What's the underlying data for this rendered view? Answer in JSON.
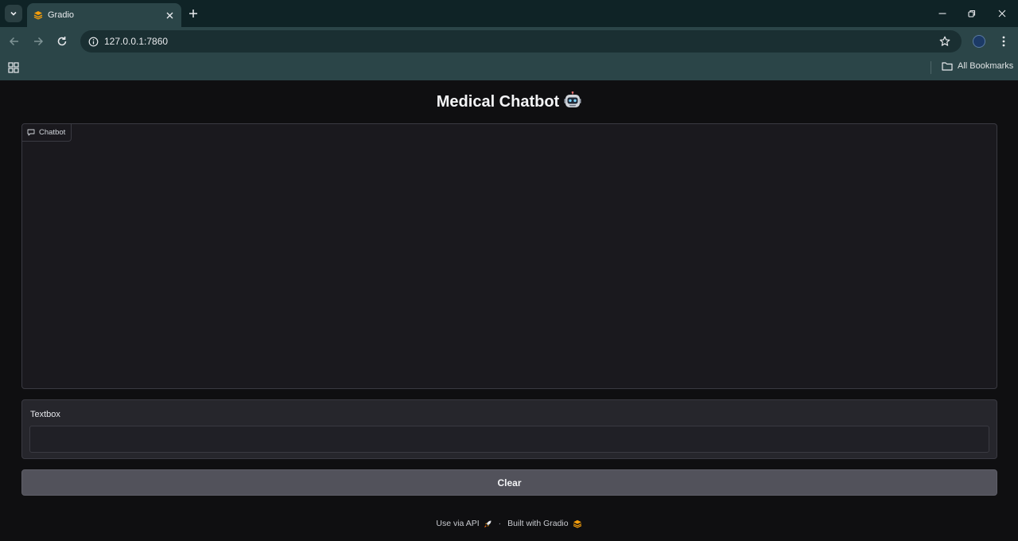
{
  "browser": {
    "tab_title": "Gradio",
    "url": "127.0.0.1:7860",
    "bookmarks_label": "All Bookmarks"
  },
  "page": {
    "title": "Medical Chatbot",
    "chatbot_label": "Chatbot",
    "textbox_label": "Textbox",
    "textbox_value": "",
    "clear_label": "Clear",
    "footer": {
      "api_label": "Use via API",
      "separator": "·",
      "built_with": "Built with Gradio"
    }
  },
  "colors": {
    "page_bg": "#0f0f11",
    "panel_bg": "#1a191e",
    "button_bg": "#52525b",
    "gradio_orange": "#f59e0b"
  }
}
